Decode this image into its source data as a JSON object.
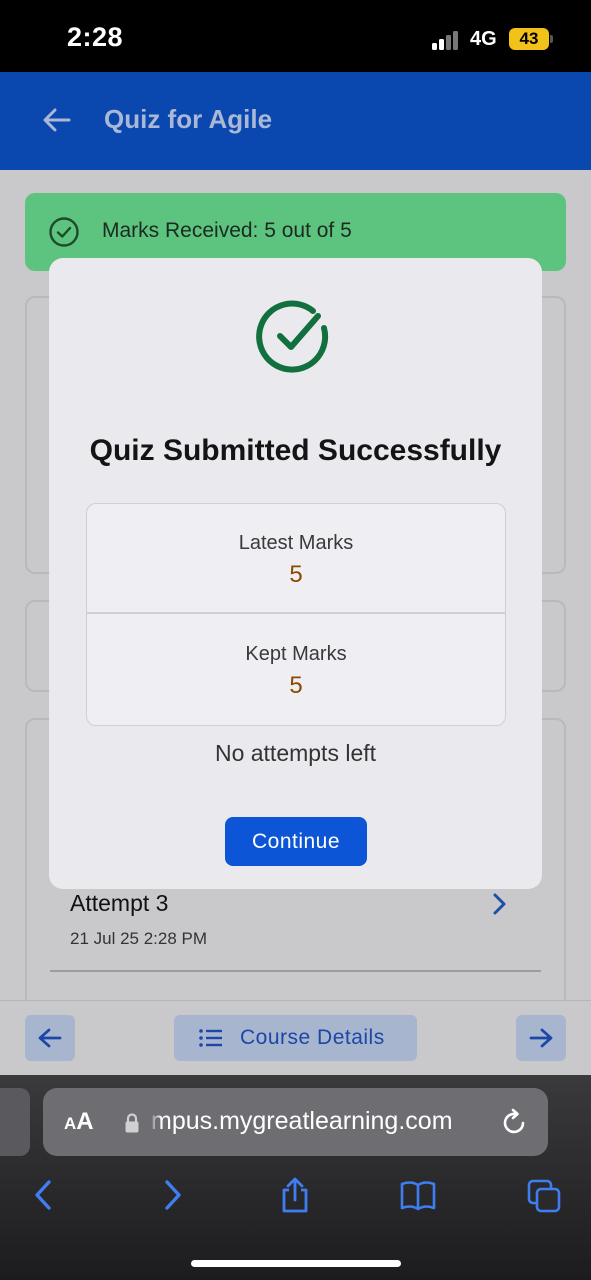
{
  "status_bar": {
    "time": "2:28",
    "network": "4G",
    "battery": "43"
  },
  "app_bar": {
    "title": "Quiz for Agile"
  },
  "banner": {
    "text": "Marks Received: 5 out of 5",
    "color": "#5cc47e"
  },
  "modal": {
    "title": "Quiz Submitted Successfully",
    "latest_label": "Latest Marks",
    "latest_value": "5",
    "kept_label": "Kept Marks",
    "kept_value": "5",
    "attempts_text": "No attempts left",
    "continue_label": "Continue",
    "check_color": "#12703f",
    "button_color": "#0b55d6"
  },
  "attempt": {
    "title": "Attempt 3",
    "date": "21 Jul 25 2:28 PM"
  },
  "bottom_nav": {
    "course_label": "Course Details"
  },
  "browser": {
    "aa_small": "A",
    "aa_large": "A",
    "url": "mpus.mygreatlearning.com"
  },
  "icons": {
    "back": "arrow-left-icon",
    "check": "check-circle-icon",
    "chevron": "chevron-right-icon",
    "list": "list-icon",
    "lock": "lock-icon",
    "reload": "reload-icon",
    "share": "share-icon",
    "bookmarks": "book-icon",
    "tabs": "tabs-icon"
  },
  "accent_color": "#0a48b0"
}
